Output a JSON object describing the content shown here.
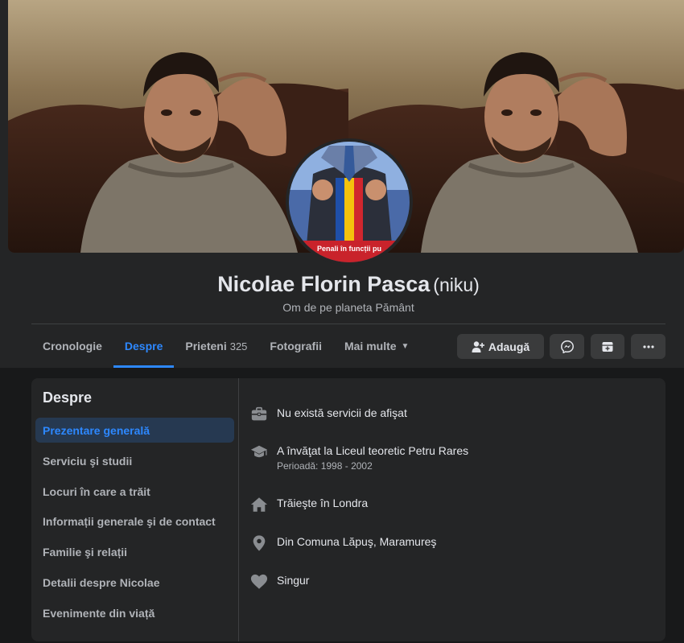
{
  "profile": {
    "name": "Nicolae Florin Pasca",
    "nickname": "(niku)",
    "bio": "Om de pe planeta Pământ",
    "avatar_caption": "Penali în funcții pu"
  },
  "tabs": [
    {
      "label": "Cronologie"
    },
    {
      "label": "Despre"
    },
    {
      "label": "Prieteni",
      "count": "325"
    },
    {
      "label": "Fotografii"
    },
    {
      "label": "Mai multe",
      "caret": "▼"
    }
  ],
  "actions": {
    "add_friend_label": "Adaugă"
  },
  "about": {
    "title": "Despre",
    "menu": [
      {
        "label": "Prezentare generală"
      },
      {
        "label": "Serviciu şi studii"
      },
      {
        "label": "Locuri în care a trăit"
      },
      {
        "label": "Informații generale şi de contact"
      },
      {
        "label": "Familie şi relații"
      },
      {
        "label": "Detalii despre Nicolae"
      },
      {
        "label": "Evenimente din viață"
      }
    ],
    "items": [
      {
        "icon": "briefcase-icon",
        "text": "Nu există servicii de afişat"
      },
      {
        "icon": "graduation-cap-icon",
        "text": "A învăţat la Liceul teoretic Petru Rares",
        "sub": "Perioadă: 1998 - 2002"
      },
      {
        "icon": "home-icon",
        "text": "Trăieşte în Londra"
      },
      {
        "icon": "location-pin-icon",
        "text": "Din Comuna Lăpuş, Maramureş"
      },
      {
        "icon": "heart-icon",
        "text": "Singur"
      }
    ]
  },
  "colors": {
    "background": "#18191a",
    "panel": "#242526",
    "accent": "#2d88ff",
    "button": "#3a3b3c",
    "secondary_text": "#b0b3b8"
  }
}
